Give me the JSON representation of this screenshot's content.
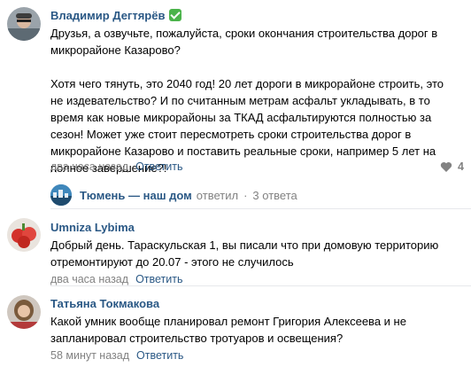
{
  "comments": [
    {
      "author": "Владимир Дегтярёв",
      "verified": true,
      "text": "Друзья, а озвучьте, пожалуйста, сроки окончания строительства дорог в\nмикрорайоне Казарово?\n\nХотя чего тянуть, это 2040 год! 20 лет дороги в микрорайоне строить, это\nне издевательство? И по считанным метрам асфальт укладывать, в то\nвремя как новые микрорайоны за ТКАД асфальтируются полностью за\nсезон! Может уже стоит пересмотреть сроки строительства дорог в\nмикрорайоне Казарово и поставить реальные сроки, например 5 лет на\nполное завершение?!",
      "time": "два часа назад",
      "reply_label": "Ответить",
      "likes": "4",
      "thread": {
        "community": "Тюмень — наш дом",
        "action": "ответил",
        "separator": "·",
        "replies": "3 ответа"
      }
    },
    {
      "author": "Umniza Lybima",
      "text": "Добрый день. Тараскульская 1, вы писали что при домовую территорию\nотремонтируют до 20.07 - этого не случилось",
      "time": "два часа назад",
      "reply_label": "Ответить"
    },
    {
      "author": "Татьяна Токмакова",
      "text": "Какой умник вообще планировал ремонт Григория Алексеева и не\nзапланировал строительство тротуаров и освещения?",
      "time": "58 минут назад",
      "reply_label": "Ответить"
    }
  ],
  "colors": {
    "link": "#2a5885",
    "meta": "#828282",
    "divider": "#e7e8ec",
    "verified": "#4bb34b"
  }
}
